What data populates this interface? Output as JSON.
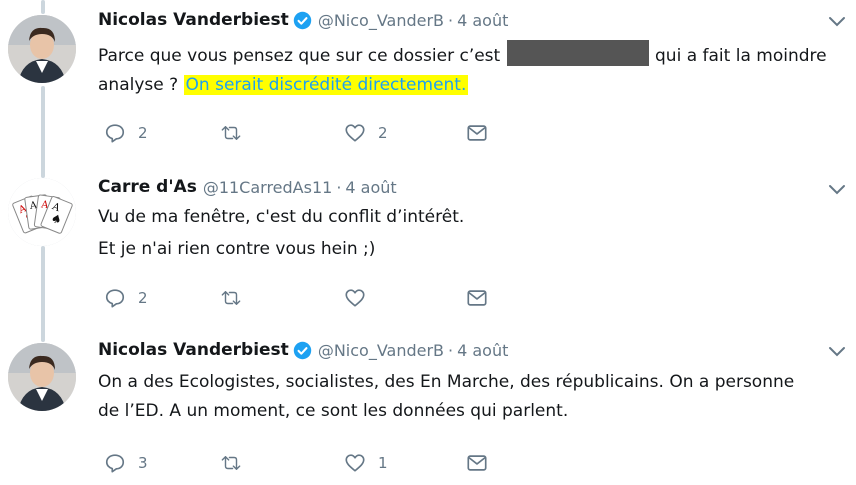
{
  "tweets": [
    {
      "name": "Nicolas Vanderbiest",
      "verified": true,
      "handle": "@Nico_VanderB",
      "separator": "·",
      "date": "4 août",
      "text_before": "Parce que vous pensez que sur ce dossier c’est",
      "text_after": "qui a fait la moindre analyse ?",
      "text_highlight": "On serait discrédité directement.",
      "reply_count": "2",
      "retweet_count": "",
      "like_count": "2"
    },
    {
      "name": "Carre d'As",
      "verified": false,
      "handle": "@11CarredAs11",
      "separator": "·",
      "date": "4 août",
      "line1": "Vu de ma fenêtre, c'est du conflit d’intérêt.",
      "line2": "Et je n'ai rien contre vous hein ;)",
      "reply_count": "2",
      "retweet_count": "",
      "like_count": ""
    },
    {
      "name": "Nicolas Vanderbiest",
      "verified": true,
      "handle": "@Nico_VanderB",
      "separator": "·",
      "date": "4 août",
      "line1": "On a des Ecologistes, socialistes, des En Marche, des républicains. On a personne",
      "line2": "de l’ED. A un moment, ce sont les données qui parlent.",
      "reply_count": "3",
      "retweet_count": "",
      "like_count": "1"
    }
  ],
  "icons": {
    "reply": "reply-icon",
    "retweet": "retweet-icon",
    "like": "heart-icon",
    "dm": "envelope-icon",
    "more": "chevron-down-icon",
    "verified": "verified-badge-icon"
  },
  "colors": {
    "text": "#14171a",
    "secondary": "#657786",
    "link": "#1da1f2",
    "highlight": "#ffff00",
    "thread": "#ccd6dd"
  }
}
